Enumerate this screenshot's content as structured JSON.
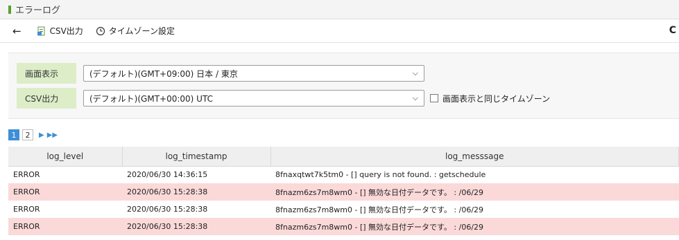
{
  "title": "エラーログ",
  "toolbar": {
    "csv_label": "CSV出力",
    "timezone_label": "タイムゾーン設定"
  },
  "timezone": {
    "display_label": "画面表示",
    "display_value": "(デフォルト)(GMT+09:00) 日本 / 東京",
    "csv_label": "CSV出力",
    "csv_value": "(デフォルト)(GMT+00:00) UTC",
    "same_tz_label": "画面表示と同じタイムゾーン"
  },
  "pager": {
    "pages": [
      "1",
      "2"
    ]
  },
  "table": {
    "columns": [
      "log_level",
      "log_timestamp",
      "log_messsage"
    ],
    "rows": [
      [
        "ERROR",
        "2020/06/30 14:36:15",
        "8fnaxqtwt7k5tm0 - [] query is not found. : getschedule"
      ],
      [
        "ERROR",
        "2020/06/30 15:28:38",
        "8fnazm6zs7m8wm0 - [] 無効な日付データです。 : /06/29"
      ],
      [
        "ERROR",
        "2020/06/30 15:28:38",
        "8fnazm6zs7m8wm0 - [] 無効な日付データです。 : /06/29"
      ],
      [
        "ERROR",
        "2020/06/30 15:28:38",
        "8fnazm6zs7m8wm0 - [] 無効な日付データです。 : /06/29"
      ]
    ]
  },
  "colors": {
    "accent": "#3d8fd6",
    "label_bg": "#dcedc8",
    "error_row": "#fbd9d9",
    "title_mark": "#5aa02c"
  }
}
